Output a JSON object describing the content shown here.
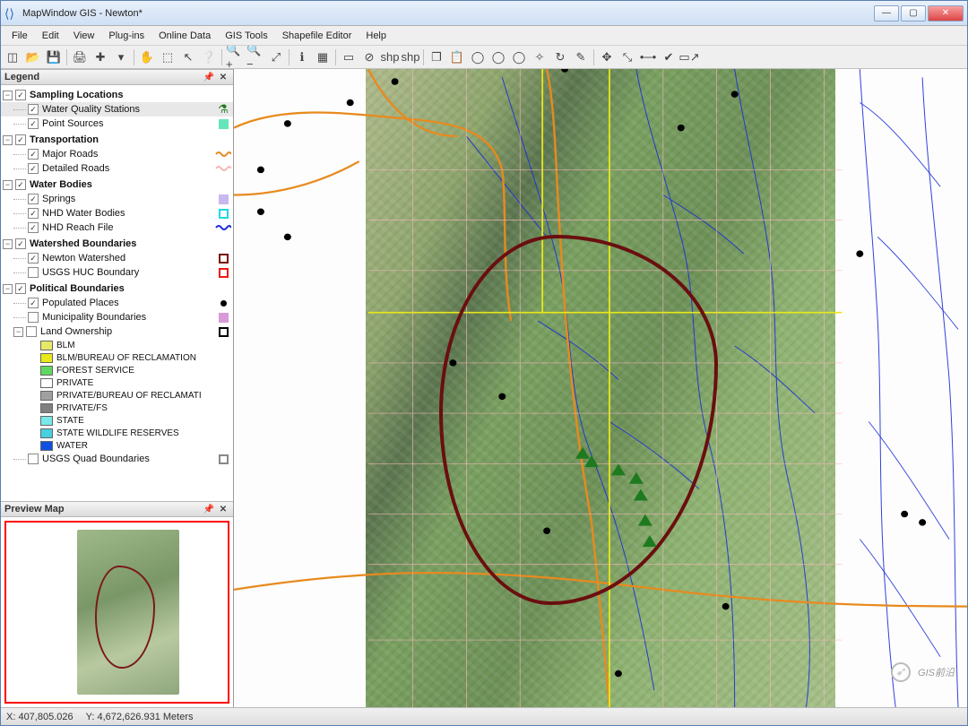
{
  "title": "MapWindow GIS  - Newton*",
  "menu": [
    "File",
    "Edit",
    "View",
    "Plug-ins",
    "Online Data",
    "GIS Tools",
    "Shapefile Editor",
    "Help"
  ],
  "toolbar": [
    {
      "name": "new-icon",
      "glyph": "◫"
    },
    {
      "name": "open-icon",
      "glyph": "📂"
    },
    {
      "name": "save-icon",
      "glyph": "💾"
    },
    {
      "sep": true
    },
    {
      "name": "print-icon",
      "glyph": "🖨"
    },
    {
      "name": "add-layer-icon",
      "glyph": "✚"
    },
    {
      "name": "dropdown-icon",
      "glyph": "▾"
    },
    {
      "sep": true
    },
    {
      "name": "pan-icon",
      "glyph": "✋"
    },
    {
      "name": "select-icon",
      "glyph": "⬚"
    },
    {
      "name": "identify-icon",
      "glyph": "↖"
    },
    {
      "name": "help-icon",
      "glyph": "❔"
    },
    {
      "sep": true
    },
    {
      "name": "zoom-in-icon",
      "glyph": "🔍+"
    },
    {
      "name": "zoom-out-icon",
      "glyph": "🔍−"
    },
    {
      "name": "zoom-full-icon",
      "glyph": "⤢"
    },
    {
      "sep": true
    },
    {
      "name": "info-icon",
      "glyph": "ℹ"
    },
    {
      "name": "table-icon",
      "glyph": "▦"
    },
    {
      "sep": true
    },
    {
      "name": "select-feat-icon",
      "glyph": "▭"
    },
    {
      "name": "deselect-icon",
      "glyph": "⊘"
    },
    {
      "name": "shp-add-icon",
      "glyph": "shp"
    },
    {
      "name": "shp-del-icon",
      "glyph": "shp"
    },
    {
      "sep": true
    },
    {
      "name": "copy-icon",
      "glyph": "❐"
    },
    {
      "name": "paste-icon",
      "glyph": "📋"
    },
    {
      "name": "circle1-icon",
      "glyph": "◯"
    },
    {
      "name": "circle2-icon",
      "glyph": "◯"
    },
    {
      "name": "circle3-icon",
      "glyph": "◯"
    },
    {
      "name": "target-icon",
      "glyph": "✧"
    },
    {
      "name": "rotate-icon",
      "glyph": "↻"
    },
    {
      "name": "draw-icon",
      "glyph": "✎"
    },
    {
      "sep": true
    },
    {
      "name": "move-icon",
      "glyph": "✥"
    },
    {
      "name": "resize-icon",
      "glyph": "⤡"
    },
    {
      "name": "node-icon",
      "glyph": "•─•"
    },
    {
      "name": "check-icon",
      "glyph": "✔"
    },
    {
      "name": "export-icon",
      "glyph": "▭↗"
    }
  ],
  "panels": {
    "legend": "Legend",
    "preview": "Preview Map"
  },
  "groups": [
    {
      "label": "Sampling Locations",
      "checked": true,
      "layers": [
        {
          "label": "Water Quality Stations",
          "checked": true,
          "sel": true,
          "sym": {
            "type": "flask",
            "color": "#1e7a1e"
          }
        },
        {
          "label": "Point Sources",
          "checked": true,
          "sym": {
            "type": "square",
            "color": "#66e6b8"
          }
        }
      ]
    },
    {
      "label": "Transportation",
      "checked": true,
      "layers": [
        {
          "label": "Major Roads",
          "checked": true,
          "sym": {
            "type": "wavy",
            "color": "#e88a1e"
          }
        },
        {
          "label": "Detailed Roads",
          "checked": true,
          "sym": {
            "type": "wavy",
            "color": "#f4b8b8"
          }
        }
      ]
    },
    {
      "label": "Water Bodies",
      "checked": true,
      "layers": [
        {
          "label": "Springs",
          "checked": true,
          "sym": {
            "type": "square",
            "color": "#c8b8ee"
          }
        },
        {
          "label": "NHD Water Bodies",
          "checked": true,
          "sym": {
            "type": "outline",
            "color": "#1ed8e8"
          }
        },
        {
          "label": "NHD Reach File",
          "checked": true,
          "sym": {
            "type": "wavy",
            "color": "#1a2ed8"
          }
        }
      ]
    },
    {
      "label": "Watershed Boundaries",
      "checked": true,
      "layers": [
        {
          "label": "Newton Watershed",
          "checked": true,
          "sym": {
            "type": "outline",
            "color": "#7a1010"
          }
        },
        {
          "label": "USGS HUC Boundary",
          "checked": false,
          "sym": {
            "type": "outline",
            "color": "#f01818"
          }
        }
      ]
    },
    {
      "label": "Political Boundaries",
      "checked": true,
      "layers": [
        {
          "label": "Populated Places",
          "checked": true,
          "sym": {
            "type": "dot",
            "color": "#000"
          }
        },
        {
          "label": "Municipality Boundaries",
          "checked": false,
          "sym": {
            "type": "square",
            "color": "#d89ad8"
          }
        },
        {
          "label": "Land Ownership",
          "checked": false,
          "sym": {
            "type": "outline",
            "color": "#000"
          },
          "subs": [
            {
              "label": "BLM",
              "color": "#e8e868"
            },
            {
              "label": "BLM/BUREAU OF RECLAMATION",
              "color": "#e8e81a"
            },
            {
              "label": "FOREST SERVICE",
              "color": "#60d860"
            },
            {
              "label": "PRIVATE",
              "color": "#ffffff"
            },
            {
              "label": "PRIVATE/BUREAU OF RECLAMATI",
              "color": "#a0a0a0"
            },
            {
              "label": "PRIVATE/FS",
              "color": "#808080"
            },
            {
              "label": "STATE",
              "color": "#78e8e8"
            },
            {
              "label": "STATE WILDLIFE RESERVES",
              "color": "#48d0e0"
            },
            {
              "label": "WATER",
              "color": "#1050e0"
            }
          ]
        },
        {
          "label": "USGS Quad Boundaries",
          "checked": false,
          "sym": {
            "type": "outline",
            "color": "#888"
          }
        }
      ]
    }
  ],
  "status": {
    "x": "X: 407,805.026",
    "y": "Y: 4,672,626.931 Meters"
  },
  "watermark": "GIS前沿"
}
